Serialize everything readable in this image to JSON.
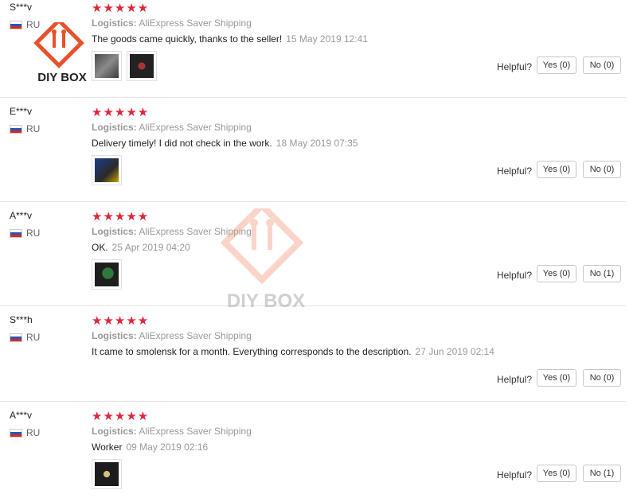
{
  "labels": {
    "logistics": "Logistics:",
    "helpful": "Helpful?"
  },
  "watermark": {
    "text": "DIY BOX",
    "color": "#e8502a"
  },
  "colors": {
    "stars": "#e1253a"
  },
  "reviews": [
    {
      "user": "S***v",
      "country": "RU",
      "stars": "★★★★★",
      "shipping": "AliExpress Saver Shipping",
      "text": "The goods came quickly, thanks to the seller!",
      "date": "15 May 2019 12:41",
      "yes": "Yes (0)",
      "no": "No (0)"
    },
    {
      "user": "E***v",
      "country": "RU",
      "stars": "★★★★★",
      "shipping": "AliExpress Saver Shipping",
      "text": "Delivery timely! I did not check in the work.",
      "date": "18 May 2019 07:35",
      "yes": "Yes (0)",
      "no": "No (0)"
    },
    {
      "user": "A***v",
      "country": "RU",
      "stars": "★★★★★",
      "shipping": "AliExpress Saver Shipping",
      "text": "OK.",
      "date": "25 Apr 2019 04:20",
      "yes": "Yes (0)",
      "no": "No (1)"
    },
    {
      "user": "S***h",
      "country": "RU",
      "stars": "★★★★★",
      "shipping": "AliExpress Saver Shipping",
      "text": "It came to smolensk for a month. Everything corresponds to the description.",
      "date": "27 Jun 2019 02:14",
      "yes": "Yes (0)",
      "no": "No (0)"
    },
    {
      "user": "A***v",
      "country": "RU",
      "stars": "★★★★★",
      "shipping": "AliExpress Saver Shipping",
      "text": "Worker",
      "date": "09 May 2019 02:16",
      "yes": "Yes (0)",
      "no": "No (1)"
    }
  ]
}
